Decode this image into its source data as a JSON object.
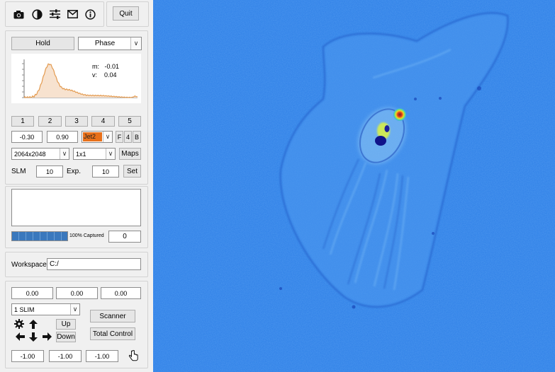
{
  "toolbar": {
    "icons": [
      "camera-icon",
      "contrast-icon",
      "sliders-icon",
      "mail-icon",
      "info-icon"
    ],
    "quit_label": "Quit"
  },
  "acquisition": {
    "hold_label": "Hold",
    "mode_value": "Phase",
    "histogram": {
      "m_text": "m:   -0.01",
      "v_text": "v:    0.04"
    },
    "channel_buttons": [
      "1",
      "2",
      "3",
      "4",
      "5"
    ],
    "range_min": "-0.30",
    "range_max": "0.90",
    "colormap": "Jet2",
    "colormap_color": "#e8701a",
    "flag_buttons": [
      "F",
      "4",
      "B"
    ],
    "resolution": "2064x2048",
    "binning": "1x1",
    "maps_label": "Maps",
    "slm_label": "SLM",
    "slm_value": "10",
    "exp_label": "Exp.",
    "exp_value": "10",
    "set_label": "Set"
  },
  "capture": {
    "progress_percent": 100,
    "progress_text": "100% Captured",
    "count_value": "0"
  },
  "workspace": {
    "label": "Workspace",
    "path": "C:/"
  },
  "stage": {
    "position": [
      "0.00",
      "0.00",
      "0.00"
    ],
    "device": "1 SLIM",
    "scanner_label": "Scanner",
    "up_label": "Up",
    "down_label": "Down",
    "total_control_label": "Total Control",
    "offsets": [
      "-1.00",
      "-1.00",
      "-1.00"
    ]
  }
}
